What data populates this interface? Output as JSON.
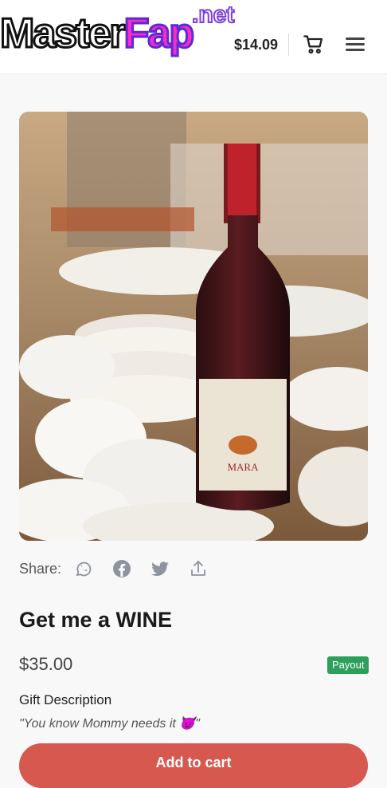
{
  "header": {
    "brand_main": "MasterFap",
    "brand_part1": "Master",
    "brand_part2": "Fap",
    "brand_tld": ".net",
    "balance": "$14.09",
    "cart_icon": "cart-icon",
    "menu_icon": "hamburger-menu-icon"
  },
  "product": {
    "image_alt": "Mara red wine bottle among stacked plates and cups",
    "bottle_label": "MARA",
    "share_label": "Share:",
    "share_icons": [
      "whatsapp-icon",
      "facebook-icon",
      "twitter-icon",
      "share-upload-icon"
    ],
    "title": "Get me a WINE",
    "price": "$35.00",
    "badge": "Payout",
    "gift_label": "Gift Description",
    "gift_text": "\"You know Mommy needs it 😈\"",
    "add_to_cart": "Add to cart"
  },
  "colors": {
    "accent": "#d6584f",
    "badge": "#2e9e5b",
    "brand_pink": "#ff29c9",
    "brand_purple": "#7b3fe0"
  }
}
